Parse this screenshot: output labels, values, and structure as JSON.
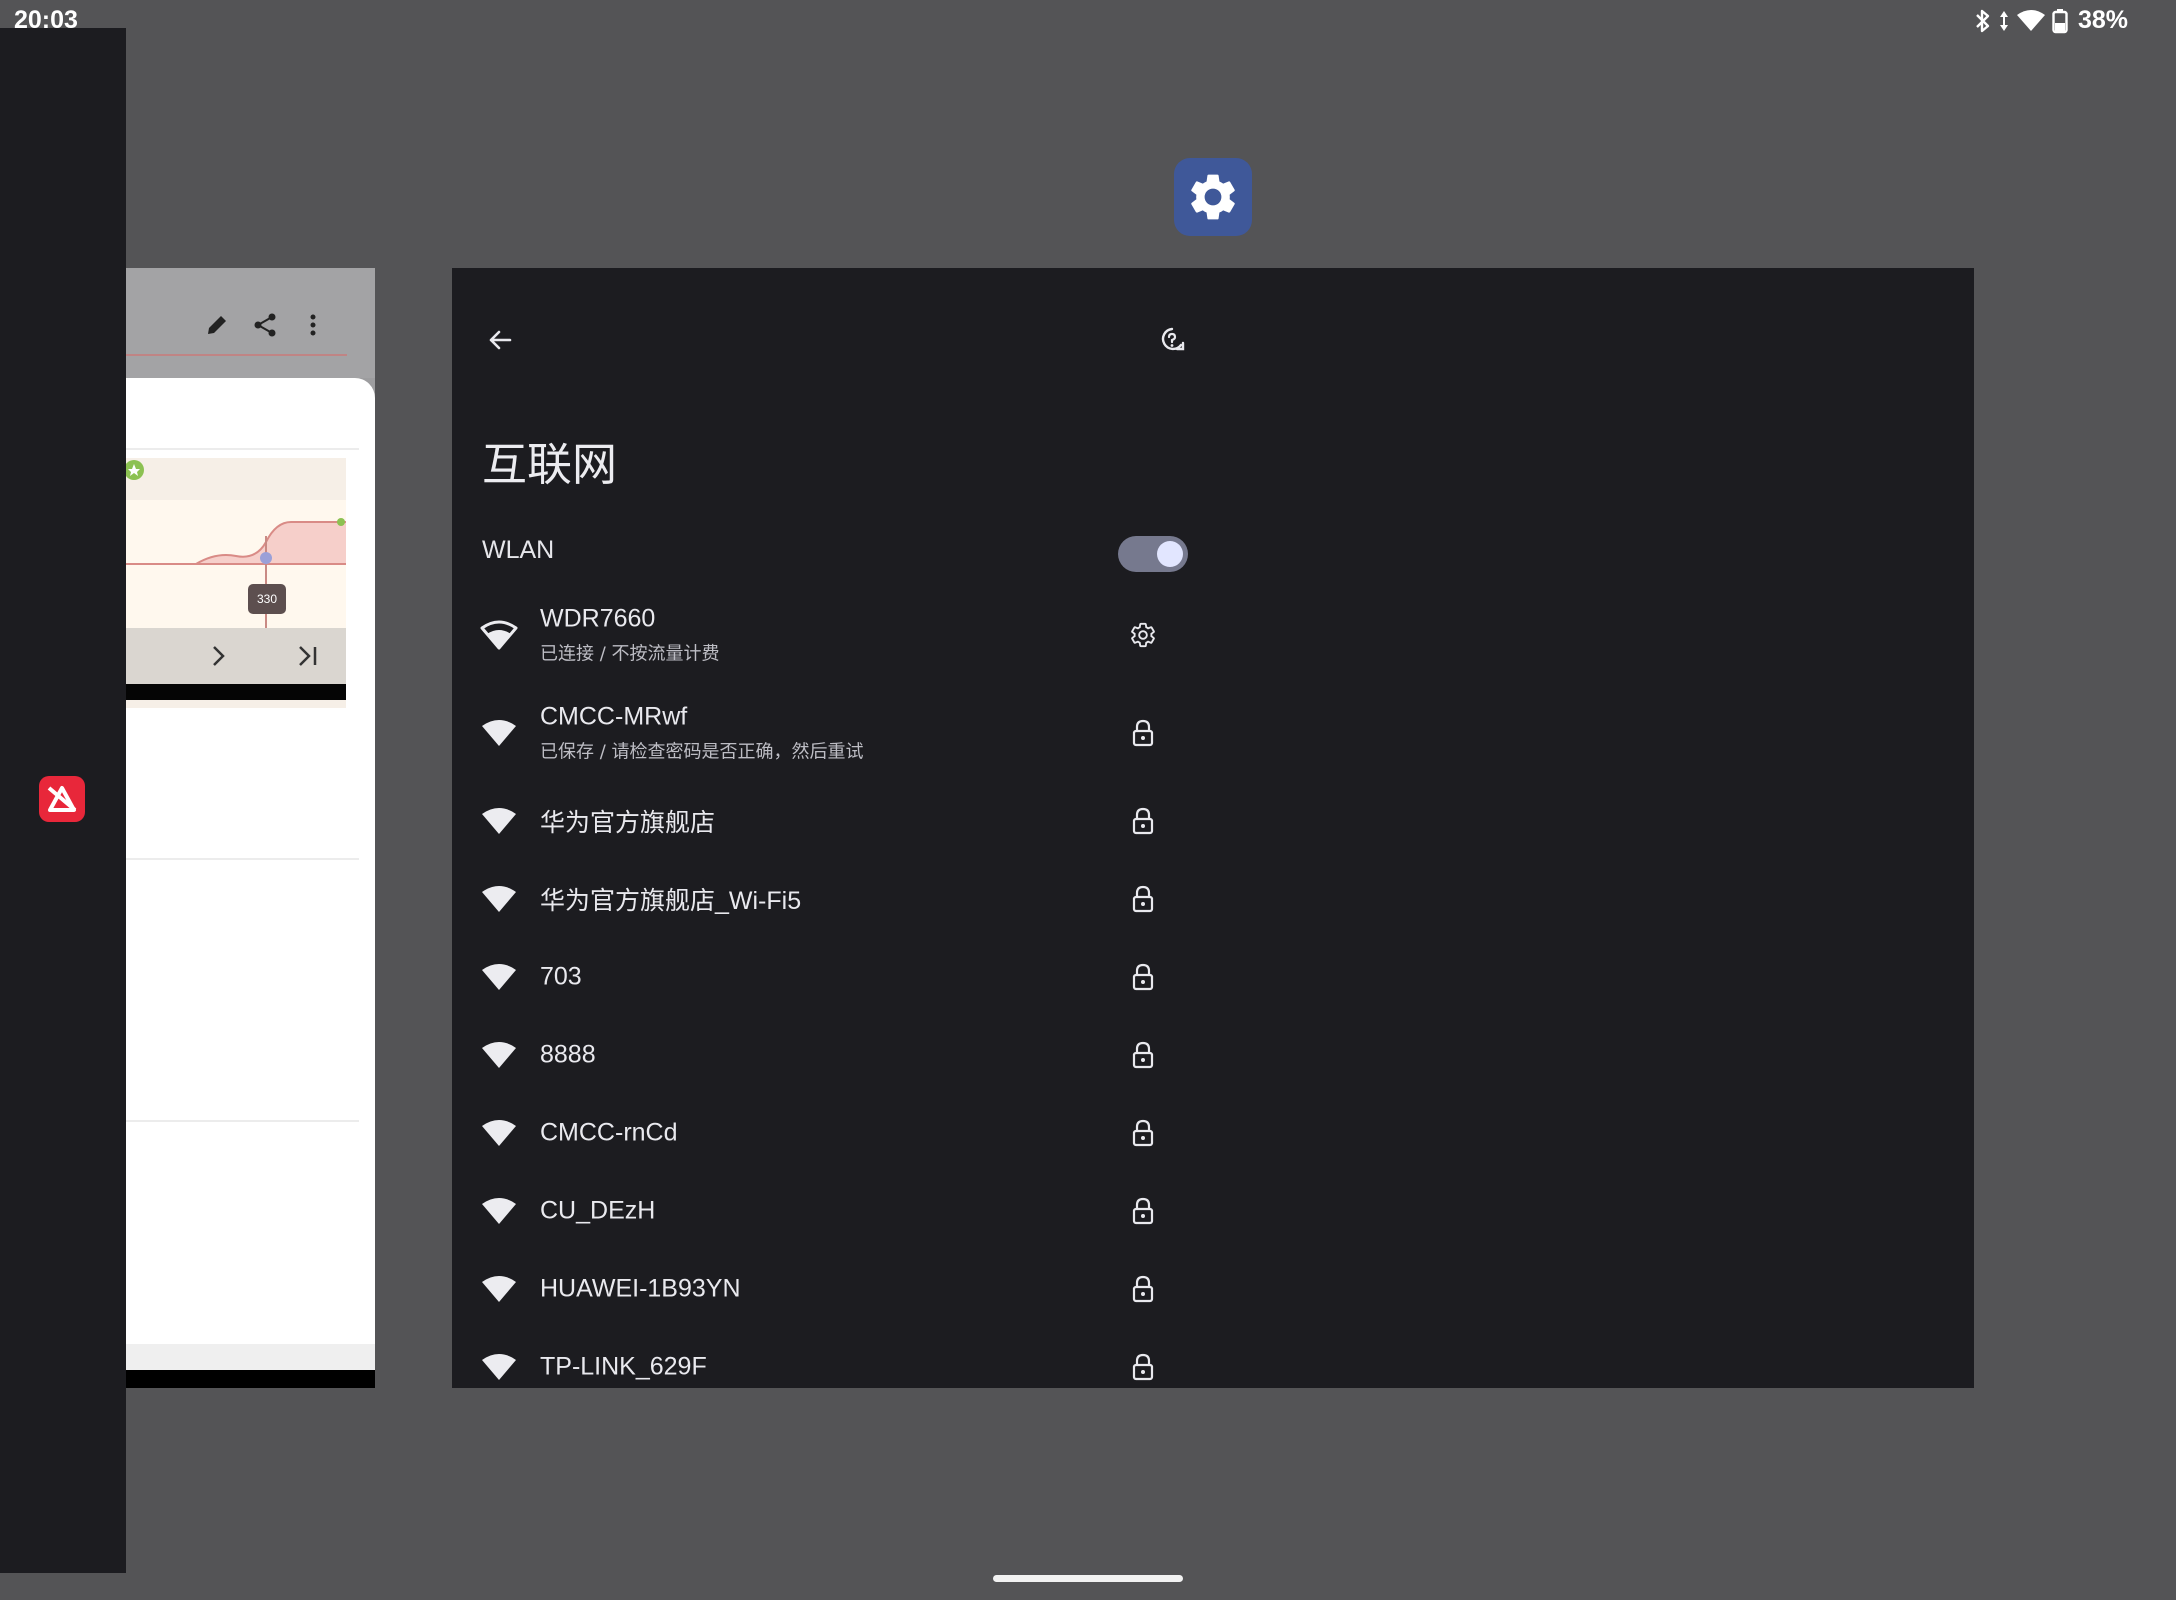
{
  "status_bar": {
    "time": "20:03",
    "battery": "38%",
    "icons": [
      "bluetooth-icon",
      "data-arrows-icon",
      "wifi-icon",
      "battery-icon"
    ]
  },
  "background_card": {
    "chart_tooltip_value": "330",
    "toolbar_icons": [
      "pencil-icon",
      "share-icon",
      "more-vert-icon"
    ],
    "nav_icons": [
      "chevron-right-icon",
      "skip-end-icon"
    ]
  },
  "settings_app": {
    "icon": "gear-icon",
    "title": "互联网",
    "wlan_label": "WLAN",
    "wlan_enabled": true,
    "networks": [
      {
        "name": "WDR7660",
        "status": "已连接 / 不按流量计费",
        "trail_icon": "gear-icon"
      },
      {
        "name": "CMCC-MRwf",
        "status": "已保存 / 请检查密码是否正确，然后重试",
        "trail_icon": "lock-icon"
      },
      {
        "name": "华为官方旗舰店",
        "status": "",
        "trail_icon": "lock-icon"
      },
      {
        "name": "华为官方旗舰店_Wi-Fi5",
        "status": "",
        "trail_icon": "lock-icon"
      },
      {
        "name": "703",
        "status": "",
        "trail_icon": "lock-icon"
      },
      {
        "name": "8888",
        "status": "",
        "trail_icon": "lock-icon"
      },
      {
        "name": "CMCC-rnCd",
        "status": "",
        "trail_icon": "lock-icon"
      },
      {
        "name": "CU_DEzH",
        "status": "",
        "trail_icon": "lock-icon"
      },
      {
        "name": "HUAWEI-1B93YN",
        "status": "",
        "trail_icon": "lock-icon"
      },
      {
        "name": "TP-LINK_629F",
        "status": "",
        "trail_icon": "lock-icon"
      }
    ]
  },
  "colors": {
    "background": "#545456",
    "window": "#1c1c20",
    "app_icon": "#3f5899",
    "toggle_track": "#76798e",
    "toggle_knob": "#e2e6ff"
  }
}
